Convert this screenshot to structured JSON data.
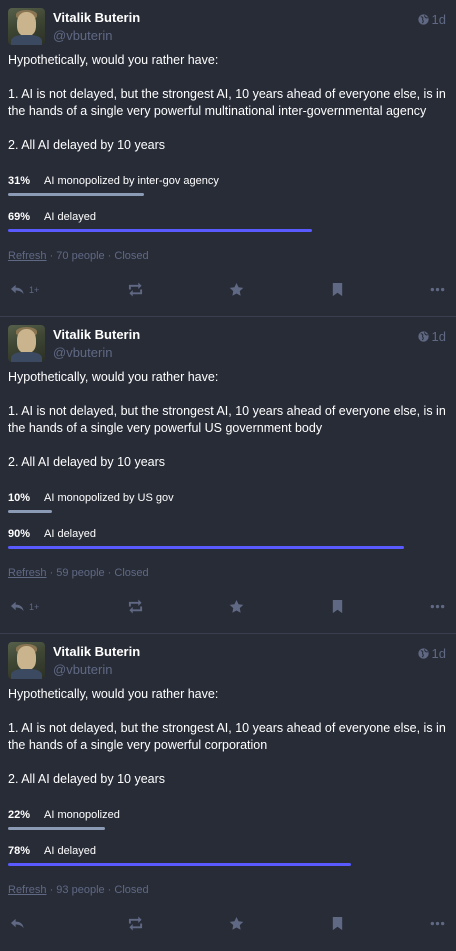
{
  "posts": [
    {
      "display_name": "Vitalik Buterin",
      "handle": "@vbuterin",
      "time": "1d",
      "intro": "Hypothetically, would you rather have:",
      "option1": "1. AI is not delayed, but the strongest AI, 10 years ahead of everyone else, is in the hands of a single very powerful multinational inter-governmental agency",
      "option2": "2. All AI delayed by 10 years",
      "poll": [
        {
          "pct_label": "31%",
          "fraction": 0.31,
          "label": "AI monopolized by inter-gov agency"
        },
        {
          "pct_label": "69%",
          "fraction": 0.69,
          "label": "AI delayed",
          "leading": true
        }
      ],
      "refresh": "Refresh",
      "meta": " · 70 people · Closed",
      "reply_count": "1+"
    },
    {
      "display_name": "Vitalik Buterin",
      "handle": "@vbuterin",
      "time": "1d",
      "intro": "Hypothetically, would you rather have:",
      "option1": "1. AI is not delayed, but the strongest AI, 10 years ahead of everyone else, is in the hands of a single very powerful US government body",
      "option2": "2. All AI delayed by 10 years",
      "poll": [
        {
          "pct_label": "10%",
          "fraction": 0.1,
          "label": "AI monopolized by US gov"
        },
        {
          "pct_label": "90%",
          "fraction": 0.9,
          "label": "AI delayed",
          "leading": true
        }
      ],
      "refresh": "Refresh",
      "meta": " · 59 people · Closed",
      "reply_count": "1+"
    },
    {
      "display_name": "Vitalik Buterin",
      "handle": "@vbuterin",
      "time": "1d",
      "intro": "Hypothetically, would you rather have:",
      "option1": "1. AI is not delayed, but the strongest AI, 10 years ahead of everyone else, is in the hands of a single very powerful corporation",
      "option2": "2. All AI delayed by 10 years",
      "poll": [
        {
          "pct_label": "22%",
          "fraction": 0.22,
          "label": "AI monopolized"
        },
        {
          "pct_label": "78%",
          "fraction": 0.78,
          "label": "AI delayed",
          "leading": true
        }
      ],
      "refresh": "Refresh",
      "meta": " · 93 people · Closed",
      "reply_count": null
    }
  ],
  "icons": {
    "visibility": "globe-icon",
    "reply": "reply-icon",
    "boost": "boost-icon",
    "favourite": "star-icon",
    "bookmark": "bookmark-icon",
    "more": "more-icon"
  },
  "colors": {
    "background": "#282c37",
    "muted_text": "#606984",
    "poll_bar_leading": "#595aff",
    "poll_bar_other": "#8c9bb5"
  }
}
